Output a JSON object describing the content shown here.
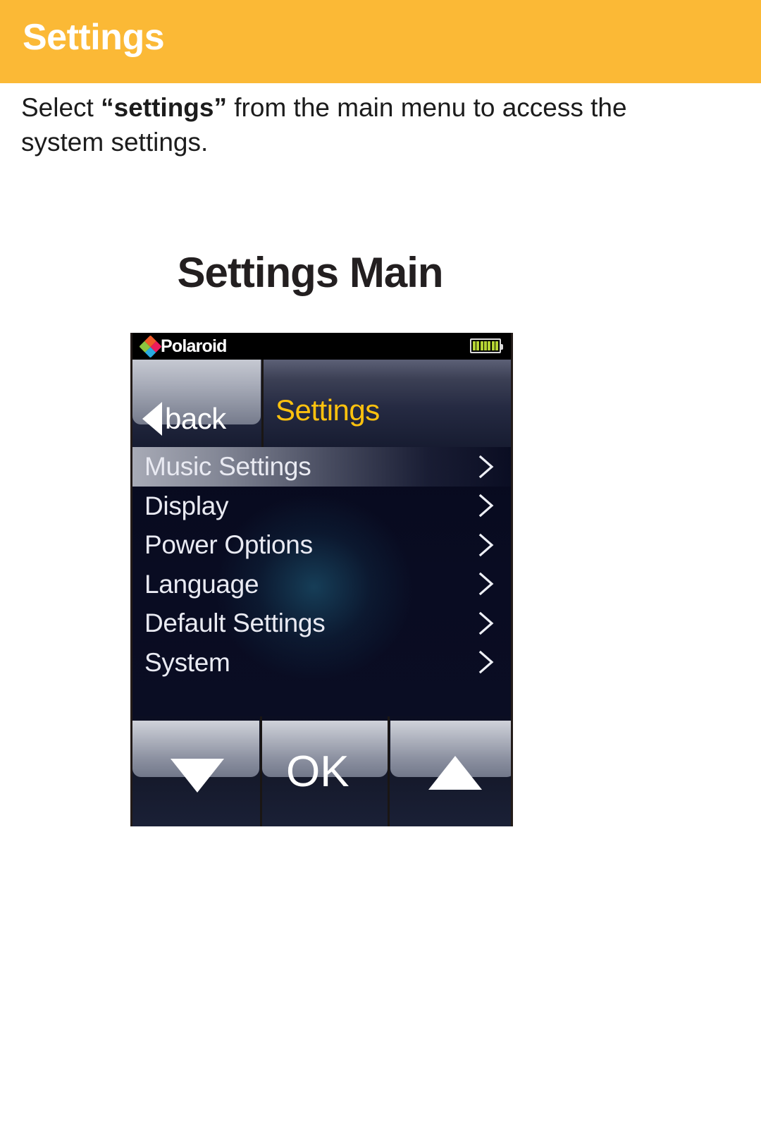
{
  "page": {
    "header_title": "Settings",
    "header_bg": "#fbb936",
    "intro_prefix": "Select ",
    "intro_quoted": "“settings”",
    "intro_suffix": " from the main menu to access the system settings.",
    "figure_title": "Settings Main"
  },
  "device": {
    "statusbar": {
      "brand": "Polaroid",
      "brand_icon": "polaroid-diamond-icon",
      "battery_icon": "battery-full-icon",
      "battery_segments": 7,
      "battery_color": "#b5d334"
    },
    "nav": {
      "back_label": "back",
      "back_icon": "left-triangle-icon",
      "title": "Settings",
      "title_color": "#ffc20e"
    },
    "menu": {
      "chevron_icon": "chevron-right-icon",
      "items": [
        {
          "label": "Music Settings",
          "selected": true
        },
        {
          "label": "Display",
          "selected": false
        },
        {
          "label": "Power Options",
          "selected": false
        },
        {
          "label": "Language",
          "selected": false
        },
        {
          "label": "Default Settings",
          "selected": false
        },
        {
          "label": "System",
          "selected": false
        }
      ]
    },
    "buttons": {
      "down_icon": "triangle-down-icon",
      "ok_label": "OK",
      "up_icon": "triangle-up-icon"
    }
  }
}
